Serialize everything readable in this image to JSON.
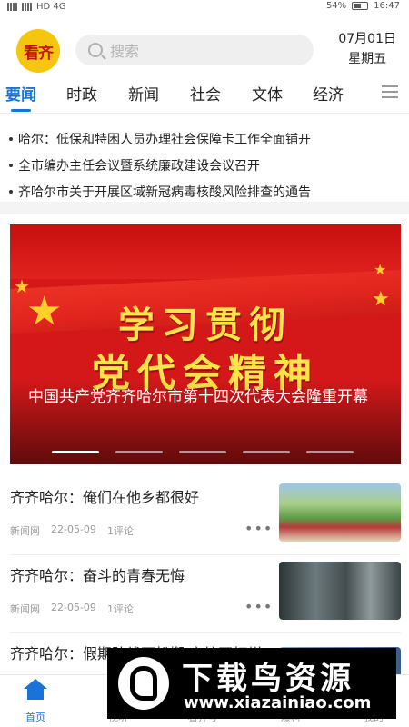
{
  "status_bar": {
    "carrier_icons": "HD 4G",
    "battery": "54%",
    "time": "16:47"
  },
  "header": {
    "logo_text": "看齐",
    "search_placeholder": "搜索",
    "date": "07月01日",
    "weekday": "星期五"
  },
  "tabs": [
    {
      "label": "要闻",
      "active": true
    },
    {
      "label": "时政"
    },
    {
      "label": "新闻"
    },
    {
      "label": "社会"
    },
    {
      "label": "文体"
    },
    {
      "label": "经济"
    }
  ],
  "headlines": [
    "哈尔：低保和特困人员办理社会保障卡工作全面铺开",
    "全市编办主任会议暨系统廉政建设会议召开",
    "齐哈尔市关于开展区域新冠病毒核酸风险排查的通告"
  ],
  "banner": {
    "title_line1": "学习贯彻",
    "title_line2": "党代会精神",
    "caption": "中国共产党齐齐哈尔市第十四次代表大会隆重开幕",
    "slide_count": 5,
    "active_slide": 1
  },
  "news": [
    {
      "title": "齐齐哈尔：俺们在他乡都很好",
      "source": "新闻网",
      "date": "22-05-09",
      "comments": "1评论"
    },
    {
      "title": "齐齐哈尔：奋斗的青春无悔",
      "source": "新闻网",
      "date": "22-05-09",
      "comments": "1评论"
    },
    {
      "title": "齐齐哈尔：假期防线不松懈 守护不打烊",
      "source": "",
      "date": "",
      "comments": ""
    }
  ],
  "bottom_nav": [
    {
      "label": "首页",
      "icon": "home-icon",
      "active": true
    },
    {
      "label": "视听",
      "icon": "video-icon"
    },
    {
      "label": "看齐号",
      "icon": "account-icon"
    },
    {
      "label": "爆料",
      "icon": "report-icon"
    },
    {
      "label": "我的",
      "icon": "user-icon"
    }
  ],
  "watermark": {
    "title": "下载鸟资源",
    "url": "www.xiazainiao.com"
  },
  "colors": {
    "accent": "#1a74d8",
    "banner_red": "#d4181a",
    "banner_gold": "#ffe34a",
    "logo_yellow": "#f5c60d"
  }
}
